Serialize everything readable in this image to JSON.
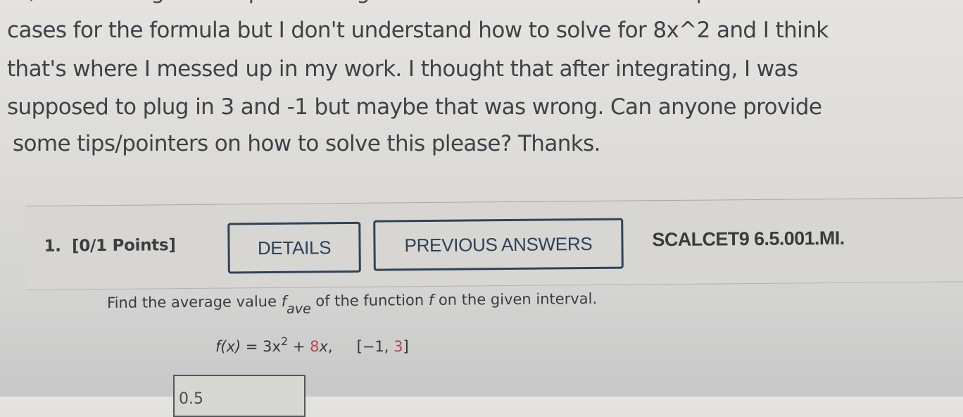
{
  "post": {
    "cutoff_line": "Hi, I'm working on this problem right now. I understand the concept and most of the",
    "lines": [
      "cases for the formula but I don't understand how to solve for 8x^2 and I think",
      "that's where I messed up in my work. I thought that after integrating, I was",
      "supposed to plug in 3 and -1 but maybe that was wrong. Can anyone provide",
      "some tips/pointers on how to solve this please? Thanks."
    ]
  },
  "question": {
    "number": "1.",
    "points": "[0/1 Points]",
    "details_label": "DETAILS",
    "previous_answers_label": "PREVIOUS ANSWERS",
    "problem_code": "SCALCET9 6.5.001.MI.",
    "prompt_before": "Find the average value ",
    "prompt_var": "f",
    "prompt_sub": "ave",
    "prompt_mid": " of the function ",
    "prompt_func": "f",
    "prompt_after": " on the given interval.",
    "equation": {
      "lhs": "f(x)",
      "equals": " = ",
      "term1": "3x",
      "exp": "2",
      "plus": " + ",
      "coef_highlight": "8",
      "term2_var": "x",
      "comma": ",",
      "interval_open": "[−1, ",
      "interval_end_highlight": "3",
      "interval_close": "]"
    },
    "answer_value": "0.5",
    "highlight_color": "#b2474d",
    "button_border_color": "#2f4358"
  }
}
